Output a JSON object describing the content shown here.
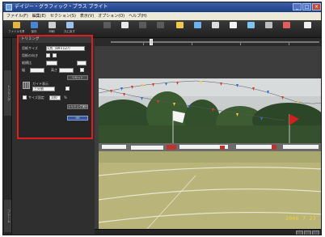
{
  "colors": {
    "highlight_frame": "#e01d1d",
    "titlebar": "#1d3f86",
    "panel_background": "#262626",
    "date_stamp": "#f2d23a"
  },
  "window": {
    "title": "デイジー・グラフィック・プラス ブライト",
    "controls": [
      "minimize-icon",
      "maximize-icon",
      "close-icon"
    ]
  },
  "menu": [
    "ファイル(F)",
    "編集(E)",
    "セクション(S)",
    "表示(V)",
    "オプション(O)",
    "ヘルプ(H)"
  ],
  "toolbar": [
    {
      "label": "ファイルを開く",
      "icon": "folder-open-icon",
      "enabled": true
    },
    {
      "label": "保存",
      "icon": "save-icon",
      "enabled": true
    },
    {
      "label": "印刷",
      "icon": "print-icon",
      "enabled": true
    },
    {
      "label": "元に戻す",
      "icon": "undo-icon",
      "enabled": true
    },
    {
      "label": "",
      "icon": "cut-icon",
      "enabled": false
    },
    {
      "label": "",
      "icon": "copy-icon",
      "enabled": true
    },
    {
      "label": "",
      "icon": "paste-icon",
      "enabled": false
    },
    {
      "label": "",
      "icon": "select-icon",
      "enabled": false
    },
    {
      "label": "",
      "icon": "crop-icon",
      "enabled": true
    },
    {
      "label": "",
      "icon": "rotate-icon",
      "enabled": true
    },
    {
      "label": "",
      "icon": "resize-icon",
      "enabled": true
    },
    {
      "label": "",
      "icon": "text-icon",
      "enabled": true
    },
    {
      "label": "",
      "icon": "filter-icon",
      "enabled": true
    },
    {
      "label": "",
      "icon": "frame-icon",
      "enabled": true
    },
    {
      "label": "",
      "icon": "brush-icon",
      "enabled": true
    },
    {
      "label": "",
      "icon": "effects-icon",
      "enabled": true
    }
  ],
  "side_tabs": [
    "トリミング",
    "フレーム"
  ],
  "panel": {
    "title": "トリミング",
    "paper_size_label": "用紙サイズ",
    "paper_size_value": "L判（89×127）",
    "orientation_label": "用紙の向き",
    "ratio_label": "縦横比",
    "width_label": "幅",
    "height_label": "高さ",
    "grid_label": "ガイド表示",
    "grid_value": "三分割",
    "fixed_label": "サイズ固定",
    "fixed_value": "100",
    "unit": "%",
    "reset_button": "リセット",
    "apply_button": "トリミング実行",
    "ok_button": "OK"
  },
  "photo": {
    "description_icon": "photo-preview",
    "date_stamp": "2006 7 23"
  },
  "view": {
    "zoom_slider_level": 0.2
  }
}
